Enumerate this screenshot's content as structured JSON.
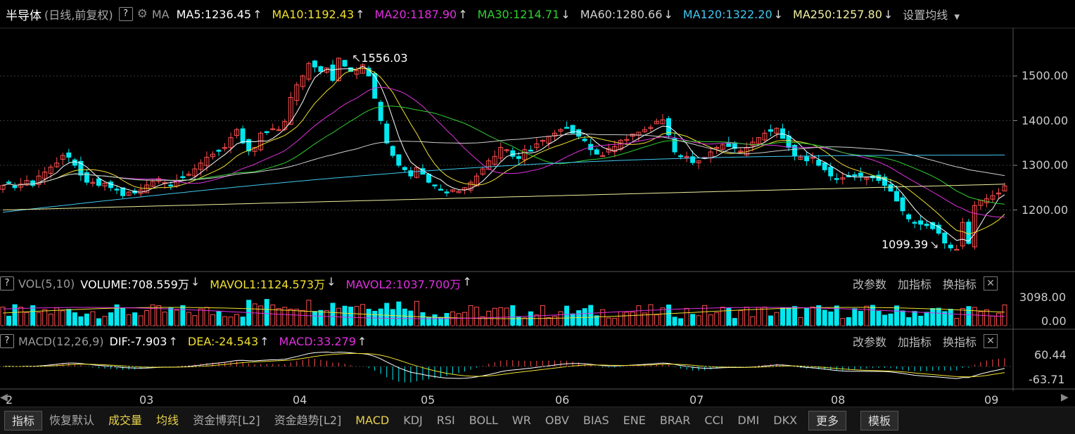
{
  "header": {
    "title": "半导体",
    "subtitle": "(日线,前复权)",
    "help_label": "?",
    "ma_label": "MA",
    "ma": [
      {
        "text": "MA5:1236.45",
        "arrow": "↑",
        "color": "#ffffff"
      },
      {
        "text": "MA10:1192.43",
        "arrow": "↑",
        "color": "#f0e030"
      },
      {
        "text": "MA20:1187.90",
        "arrow": "↑",
        "color": "#e030e0"
      },
      {
        "text": "MA30:1214.71",
        "arrow": "↓",
        "color": "#30d030"
      },
      {
        "text": "MA60:1280.66",
        "arrow": "↓",
        "color": "#d0d0d0"
      },
      {
        "text": "MA120:1322.20",
        "arrow": "↓",
        "color": "#40c8f0"
      },
      {
        "text": "MA250:1257.80",
        "arrow": "↓",
        "color": "#f0f0a0"
      }
    ],
    "settings_label": "设置均线"
  },
  "price_axis": [
    "1500.00",
    "1400.00",
    "1300.00",
    "1200.00"
  ],
  "annotations": {
    "high": "1556.03",
    "low": "1099.39"
  },
  "vol_panel": {
    "help_label": "?",
    "name": "VOL(5,10)",
    "items": [
      {
        "text": "VOLUME:708.559万",
        "arrow": "↓",
        "color": "#ffffff"
      },
      {
        "text": "MAVOL1:1124.573万",
        "arrow": "↓",
        "color": "#f0e030"
      },
      {
        "text": "MAVOL2:1037.700万",
        "arrow": "↑",
        "color": "#e030e0"
      }
    ],
    "axis": [
      "3098.00",
      "0.00"
    ],
    "controls": [
      "改参数",
      "加指标",
      "换指标"
    ],
    "close_label": "✕"
  },
  "macd_panel": {
    "help_label": "?",
    "name": "MACD(12,26,9)",
    "items": [
      {
        "text": "DIF:-7.903",
        "arrow": "↑",
        "color": "#ffffff"
      },
      {
        "text": "DEA:-24.543",
        "arrow": "↑",
        "color": "#f0e030"
      },
      {
        "text": "MACD:33.279",
        "arrow": "↑",
        "color": "#e030e0"
      }
    ],
    "axis": [
      "60.44",
      "-63.71"
    ],
    "controls": [
      "改参数",
      "加指标",
      "换指标"
    ],
    "close_label": "✕"
  },
  "x_axis": [
    "2",
    "03",
    "04",
    "05",
    "06",
    "07",
    "08",
    "09"
  ],
  "tabs": [
    "指标",
    "恢复默认",
    "成交量",
    "均线",
    "资金博弈[L2]",
    "资金趋势[L2]",
    "MACD",
    "KDJ",
    "RSI",
    "BOLL",
    "WR",
    "OBV",
    "BIAS",
    "ENE",
    "BRAR",
    "CCI",
    "DMI",
    "DKX",
    "更多",
    "模板"
  ],
  "colors": {
    "up": "#ff5050",
    "down": "#00e8f0",
    "bg": "#000000",
    "grid": "#3a3a3a"
  },
  "chart_data": {
    "type": "candlestick",
    "price_axis_ticks": [
      1200,
      1300,
      1400,
      1500
    ],
    "price_range_visible": [
      1099.39,
      1556.03
    ],
    "x_tick_labels": [
      "2",
      "03",
      "04",
      "05",
      "06",
      "07",
      "08",
      "09"
    ],
    "indicators": {
      "MA5": 1236.45,
      "MA10": 1192.43,
      "MA20": 1187.9,
      "MA30": 1214.71,
      "MA60": 1280.66,
      "MA120": 1322.2,
      "MA250": 1257.8
    },
    "volume": {
      "VOLUME": "708.559万",
      "MAVOL1": "1124.573万",
      "MAVOL2": "1037.700万",
      "axis": [
        0,
        3098
      ]
    },
    "macd": {
      "DIF": -7.903,
      "DEA": -24.543,
      "MACD": 33.279,
      "axis": [
        -63.71,
        60.44
      ]
    },
    "closes": [
      1255,
      1262,
      1250,
      1258,
      1266,
      1255,
      1276,
      1285,
      1296,
      1305,
      1322,
      1318,
      1300,
      1278,
      1262,
      1262,
      1255,
      1260,
      1250,
      1245,
      1232,
      1240,
      1238,
      1245,
      1256,
      1264,
      1270,
      1262,
      1255,
      1266,
      1274,
      1280,
      1292,
      1305,
      1318,
      1325,
      1332,
      1340,
      1362,
      1380,
      1350,
      1332,
      1340,
      1372,
      1375,
      1382,
      1380,
      1398,
      1452,
      1480,
      1500,
      1528,
      1520,
      1510,
      1518,
      1490,
      1540,
      1522,
      1510,
      1512,
      1525,
      1500,
      1450,
      1400,
      1350,
      1322,
      1300,
      1290,
      1276,
      1295,
      1280,
      1262,
      1255,
      1246,
      1240,
      1245,
      1242,
      1250,
      1262,
      1276,
      1292,
      1310,
      1320,
      1340,
      1335,
      1320,
      1315,
      1335,
      1332,
      1348,
      1356,
      1365,
      1372,
      1380,
      1385,
      1372,
      1365,
      1355,
      1335,
      1325,
      1322,
      1338,
      1342,
      1356,
      1358,
      1370,
      1374,
      1380,
      1385,
      1398,
      1402,
      1368,
      1330,
      1320,
      1320,
      1306,
      1310,
      1318,
      1330,
      1340,
      1346,
      1342,
      1338,
      1332,
      1340,
      1352,
      1362,
      1372,
      1376,
      1383,
      1360,
      1340,
      1322,
      1318,
      1310,
      1318,
      1300,
      1290,
      1276,
      1270,
      1272,
      1274,
      1276,
      1276,
      1272,
      1272,
      1266,
      1255,
      1242,
      1220,
      1198,
      1180,
      1172,
      1168,
      1165,
      1158,
      1148,
      1126,
      1115,
      1112,
      1172,
      1125,
      1210,
      1222,
      1225,
      1232,
      1238,
      1254
    ]
  }
}
